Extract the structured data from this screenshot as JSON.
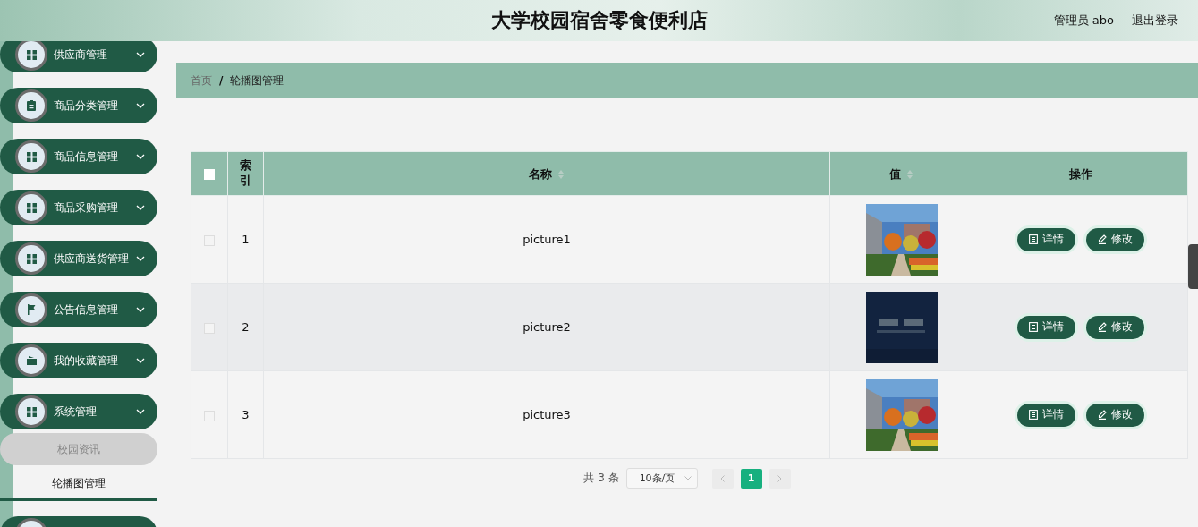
{
  "header": {
    "title": "大学校园宿舍零食便利店",
    "user": "管理员 abo",
    "logout": "退出登录"
  },
  "sidebar": {
    "menus": [
      {
        "label": "供应商管理",
        "kind": "grid"
      },
      {
        "label": "商品分类管理",
        "kind": "clipboard"
      },
      {
        "label": "商品信息管理",
        "kind": "grid"
      },
      {
        "label": "商品采购管理",
        "kind": "grid"
      },
      {
        "label": "供应商送货管理",
        "kind": "grid"
      },
      {
        "label": "公告信息管理",
        "kind": "flag"
      },
      {
        "label": "我的收藏管理",
        "kind": "wallet"
      },
      {
        "label": "系统管理",
        "kind": "grid",
        "children": [
          {
            "label": "校园资讯",
            "selected": false
          },
          {
            "label": "轮播图管理",
            "selected": true
          }
        ]
      }
    ]
  },
  "breadcrumb": [
    {
      "label": "首页",
      "current": false
    },
    {
      "separator": "/"
    },
    {
      "label": "轮播图管理",
      "current": true
    }
  ],
  "table": {
    "columns": [
      {
        "kind": "check",
        "checked": false
      },
      {
        "kind": "narrow",
        "label": "索引"
      },
      {
        "kind": "sort",
        "label": "名称"
      },
      {
        "kind": "sort",
        "label": "值"
      },
      {
        "kind": "text",
        "label": "操作"
      }
    ],
    "rows": [
      {
        "index": "1",
        "name": "picture1",
        "image": {
          "kind": "picture"
        },
        "checked": false,
        "actions": [
          "详情",
          "修改"
        ]
      },
      {
        "index": "2",
        "name": "picture2",
        "image": {
          "kind": "picture"
        },
        "checked": false,
        "actions": [
          "详情",
          "修改"
        ]
      },
      {
        "index": "3",
        "name": "picture3",
        "image": {
          "kind": "picture"
        },
        "checked": false,
        "actions": [
          "详情",
          "修改"
        ]
      }
    ]
  },
  "pagination": {
    "total": "共 3 条",
    "page_size": "10条/页",
    "pages": [
      {
        "label": "1",
        "selected": true
      }
    ]
  }
}
